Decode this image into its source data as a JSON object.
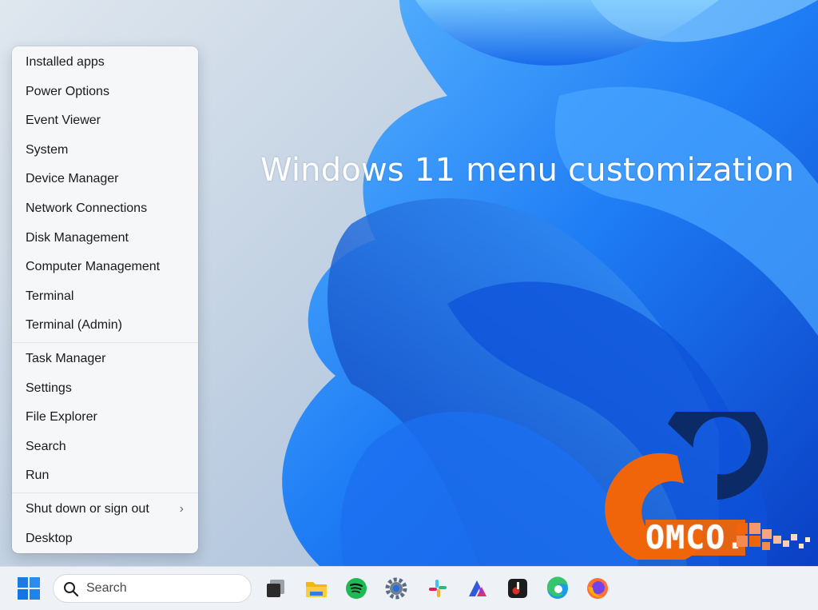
{
  "wallpaper": {
    "headline": "Windows 11 menu customization",
    "logo_text": "OMCO."
  },
  "context_menu": {
    "groups": [
      [
        "Installed apps",
        "Power Options",
        "Event Viewer",
        "System",
        "Device Manager",
        "Network Connections",
        "Disk Management",
        "Computer Management",
        "Terminal",
        "Terminal (Admin)"
      ],
      [
        "Task Manager",
        "Settings",
        "File Explorer",
        "Search",
        "Run"
      ],
      [
        "Shut down or sign out",
        "Desktop"
      ]
    ],
    "submenu_chevron": "›"
  },
  "taskbar": {
    "search_placeholder": "Search",
    "pinned_icons": [
      "start-windows-icon",
      "task-view-icon",
      "file-explorer-icon",
      "spotify-icon",
      "settings-gear-icon",
      "slack-icon",
      "affinity-icon",
      "guitar-app-icon",
      "edge-icon",
      "firefox-icon"
    ]
  },
  "colors": {
    "windows_blue": "#0a6cf0",
    "logo_orange": "#f0650a",
    "logo_navy": "#0b2a66"
  }
}
